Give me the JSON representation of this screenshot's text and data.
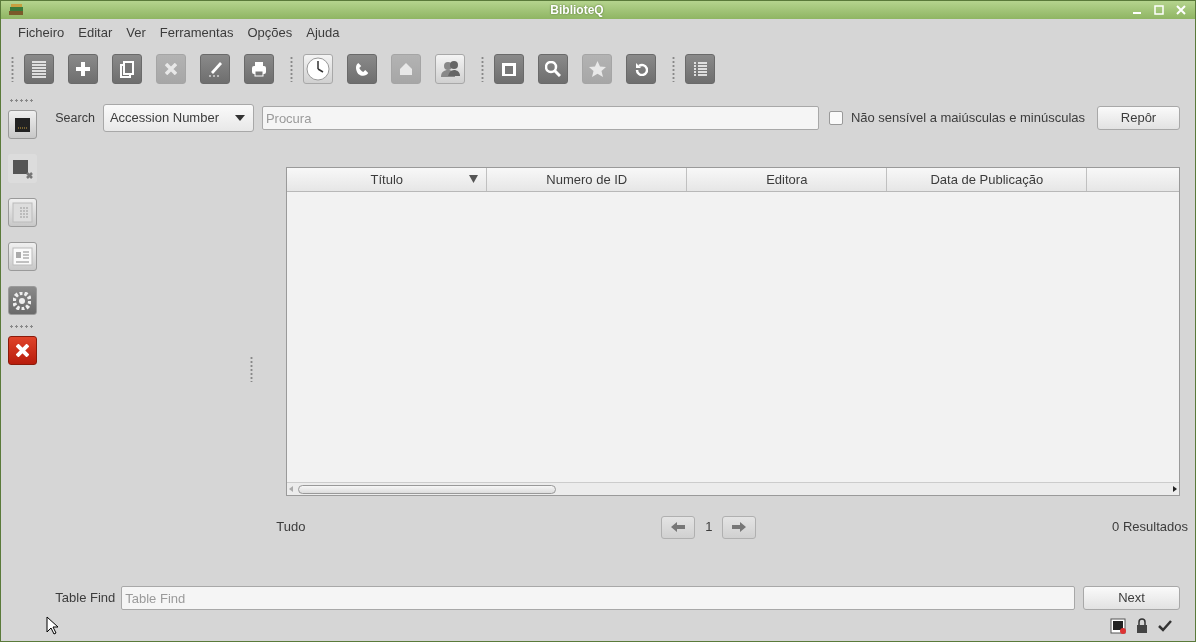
{
  "window": {
    "title": "BiblioteQ"
  },
  "menu": [
    "Ficheiro",
    "Editar",
    "Ver",
    "Ferramentas",
    "Opções",
    "Ajuda"
  ],
  "toolbar": {
    "groups": [
      [
        {
          "disabled": false
        },
        {
          "disabled": false
        },
        {
          "disabled": false
        },
        {
          "disabled": true
        },
        {
          "disabled": false
        },
        {
          "disabled": false
        }
      ],
      [
        {
          "disabled": false
        },
        {
          "disabled": false
        },
        {
          "disabled": true
        },
        {
          "disabled": false
        }
      ],
      [
        {
          "disabled": false
        },
        {
          "disabled": false
        },
        {
          "disabled": true
        },
        {
          "disabled": false
        }
      ],
      [
        {
          "disabled": false
        }
      ]
    ]
  },
  "search": {
    "label": "Search",
    "field_select": "Accession Number",
    "placeholder": "Procura",
    "case_insensitive": {
      "label": "Não sensível a maiúsculas e minúsculas",
      "checked": false
    },
    "reset_button": "Repôr"
  },
  "table": {
    "columns": [
      {
        "label": "Título",
        "sorted": true
      },
      {
        "label": "Numero de ID",
        "sorted": false
      },
      {
        "label": "Editora",
        "sorted": false
      },
      {
        "label": "Data de Publicação",
        "sorted": false
      }
    ]
  },
  "pager": {
    "scope": "Tudo",
    "page": "1",
    "results": "0 Resultados"
  },
  "table_find": {
    "label": "Table Find",
    "placeholder": "Table Find",
    "button": "Next"
  }
}
